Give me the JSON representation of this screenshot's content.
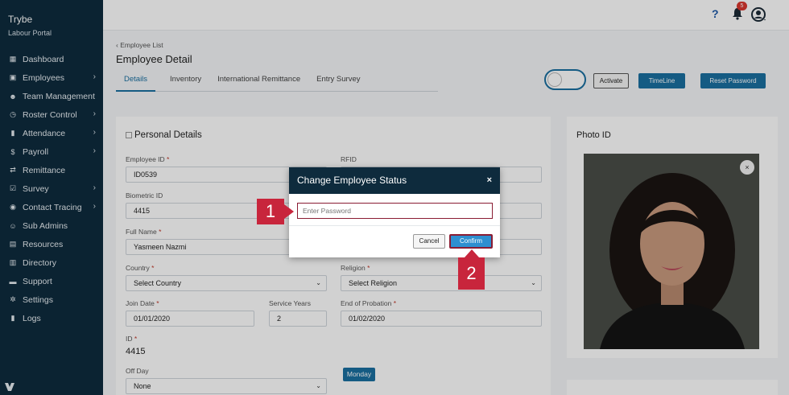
{
  "sidebar": {
    "brand": "Trybe",
    "subtitle": "Labour Portal",
    "items": [
      {
        "label": "Dashboard",
        "icon": "dashboard-icon",
        "chevron": false
      },
      {
        "label": "Employees",
        "icon": "id-card-icon",
        "chevron": true
      },
      {
        "label": "Team Management",
        "icon": "team-icon",
        "chevron": false
      },
      {
        "label": "Roster Control",
        "icon": "clock-icon",
        "chevron": true
      },
      {
        "label": "Attendance",
        "icon": "book-icon",
        "chevron": true
      },
      {
        "label": "Payroll",
        "icon": "dollar-icon",
        "chevron": true
      },
      {
        "label": "Remittance",
        "icon": "transfer-icon",
        "chevron": false
      },
      {
        "label": "Survey",
        "icon": "survey-icon",
        "chevron": true
      },
      {
        "label": "Contact Tracing",
        "icon": "map-pin-icon",
        "chevron": true
      },
      {
        "label": "Sub Admins",
        "icon": "users-icon",
        "chevron": false
      },
      {
        "label": "Resources",
        "icon": "box-icon",
        "chevron": false
      },
      {
        "label": "Directory",
        "icon": "building-icon",
        "chevron": false
      },
      {
        "label": "Support",
        "icon": "chat-icon",
        "chevron": false
      },
      {
        "label": "Settings",
        "icon": "gear-icon",
        "chevron": false
      },
      {
        "label": "Logs",
        "icon": "log-icon",
        "chevron": false
      }
    ]
  },
  "topbar": {
    "help": "?",
    "notification_count": "5"
  },
  "page": {
    "breadcrumb": "Employee List",
    "title": "Employee Detail",
    "tabs": [
      "Details",
      "Inventory",
      "International Remittance",
      "Entry Survey"
    ],
    "actions": {
      "activate": "Activate",
      "timeline": "TimeLine",
      "reset_password": "Reset Password"
    }
  },
  "personal": {
    "section_title": "Personal Details",
    "employee_id_label": "Employee ID",
    "employee_id": "ID0539",
    "rfid_label": "RFID",
    "biometric_label": "Biometric ID",
    "biometric_id": "4415",
    "full_name_label": "Full Name",
    "full_name": "Yasmeen Nazmi",
    "country_label": "Country",
    "country": "Select Country",
    "religion_label": "Religion",
    "religion": "Select Religion",
    "join_date_label": "Join Date",
    "join_date": "01/01/2020",
    "service_years_label": "Service Years",
    "service_years": "2",
    "end_probation_label": "End of Probation",
    "end_probation": "01/02/2020",
    "id_label": "ID",
    "id_value": "4415",
    "off_day_label": "Off Day",
    "off_day": "None",
    "day_button": "Monday",
    "required_mark": "*"
  },
  "photo": {
    "title": "Photo ID",
    "remove": "×"
  },
  "modal": {
    "title": "Change Employee Status",
    "close": "×",
    "password_placeholder": "Enter Password",
    "cancel": "Cancel",
    "confirm": "Confirm"
  },
  "annotations": {
    "step1": "1",
    "step2": "2"
  },
  "colors": {
    "sidebar_bg": "#0e2b3d",
    "accent": "#1a6fa0",
    "annotation": "#c8253c",
    "badge": "#d9382f"
  }
}
